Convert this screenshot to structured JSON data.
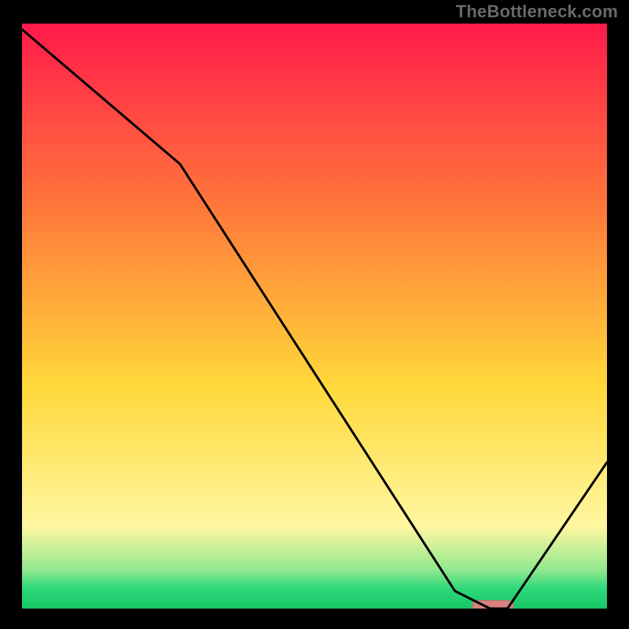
{
  "watermark": "TheBottleneck.com",
  "colors": {
    "black": "#000000",
    "curve_stroke": "#000000",
    "marker_fill": "#d98080",
    "marker_stroke": "#c86868",
    "grad_top": "#ff1a4a",
    "grad_upper": "#ff7d3a",
    "grad_mid": "#ffd83a",
    "grad_lower": "#fff7a0",
    "grad_green1": "#8fe88f",
    "grad_green2": "#2fd87a",
    "grad_green3": "#17c766"
  },
  "chart_data": {
    "type": "line",
    "title": "",
    "xlabel": "",
    "ylabel": "",
    "xlim": [
      0,
      100
    ],
    "ylim": [
      0,
      100
    ],
    "x": [
      0,
      27,
      74,
      80,
      83,
      100
    ],
    "values": [
      99,
      76,
      3,
      0,
      0,
      25
    ],
    "annotations": [
      {
        "kind": "min-marker",
        "x_start": 77,
        "x_end": 84,
        "y": 0.5
      }
    ]
  }
}
